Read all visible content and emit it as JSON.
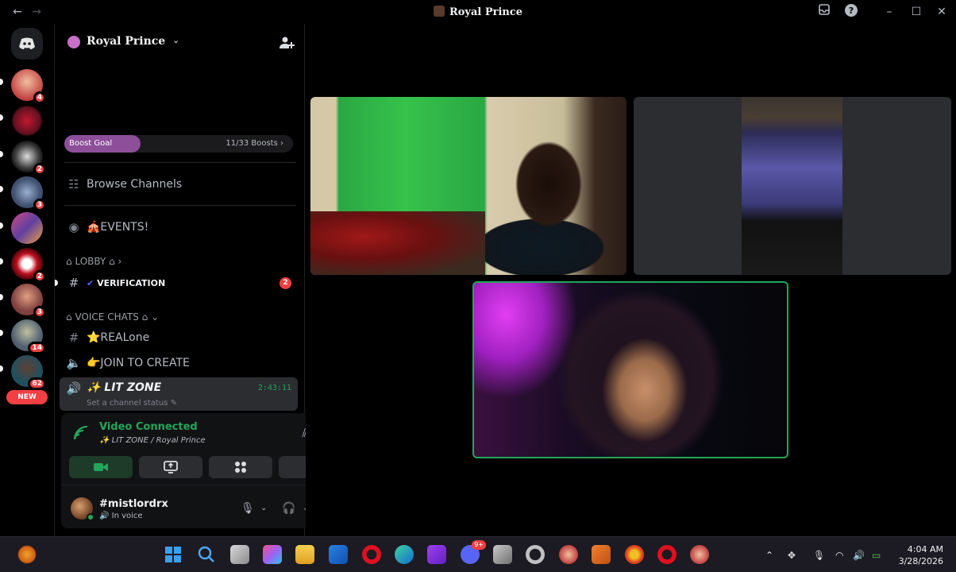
{
  "window": {
    "title": "Royal Prince"
  },
  "rail": {
    "servers": [
      {
        "name": "server-1",
        "badge": "4"
      },
      {
        "name": "server-2",
        "badge": ""
      },
      {
        "name": "server-3",
        "badge": "2"
      },
      {
        "name": "server-4",
        "badge": "3"
      },
      {
        "name": "server-5",
        "badge": ""
      },
      {
        "name": "server-6",
        "badge": "2"
      },
      {
        "name": "server-7",
        "badge": "3"
      },
      {
        "name": "server-8",
        "badge": "14"
      },
      {
        "name": "server-9",
        "badge": "62"
      }
    ],
    "new_label": "NEW"
  },
  "server": {
    "name": "Royal Prince",
    "boost_label": "Boost Goal",
    "boost_count": "11/33 Boosts",
    "boost_progress": 0.333
  },
  "channels": {
    "browse": "Browse Channels",
    "events": "🎪EVENTS!",
    "lobby_category": "LOBBY",
    "verification": "VERIFICATION",
    "verification_mentions": "2",
    "voice_category": "VOICE CHATS",
    "realone": "⭐REALone",
    "join_to_create": "👉JOIN TO CREATE",
    "lit_zone": "✨ LIT ZONE",
    "lit_zone_timer": "2:43:11",
    "lit_zone_status": "Set a channel status"
  },
  "voice_panel": {
    "title": "Video Connected",
    "subtitle": "✨ LIT ZONE / Royal Prince"
  },
  "user": {
    "name": "#mistlordrx",
    "status": "In voice"
  },
  "taskbar": {
    "discord_badge": "9+",
    "time": "4:04 AM",
    "date": "3/28/2026"
  },
  "colors": {
    "accent_green": "#23a55a",
    "mention_red": "#f23f43",
    "boost_purple": "#8d4f9a"
  }
}
